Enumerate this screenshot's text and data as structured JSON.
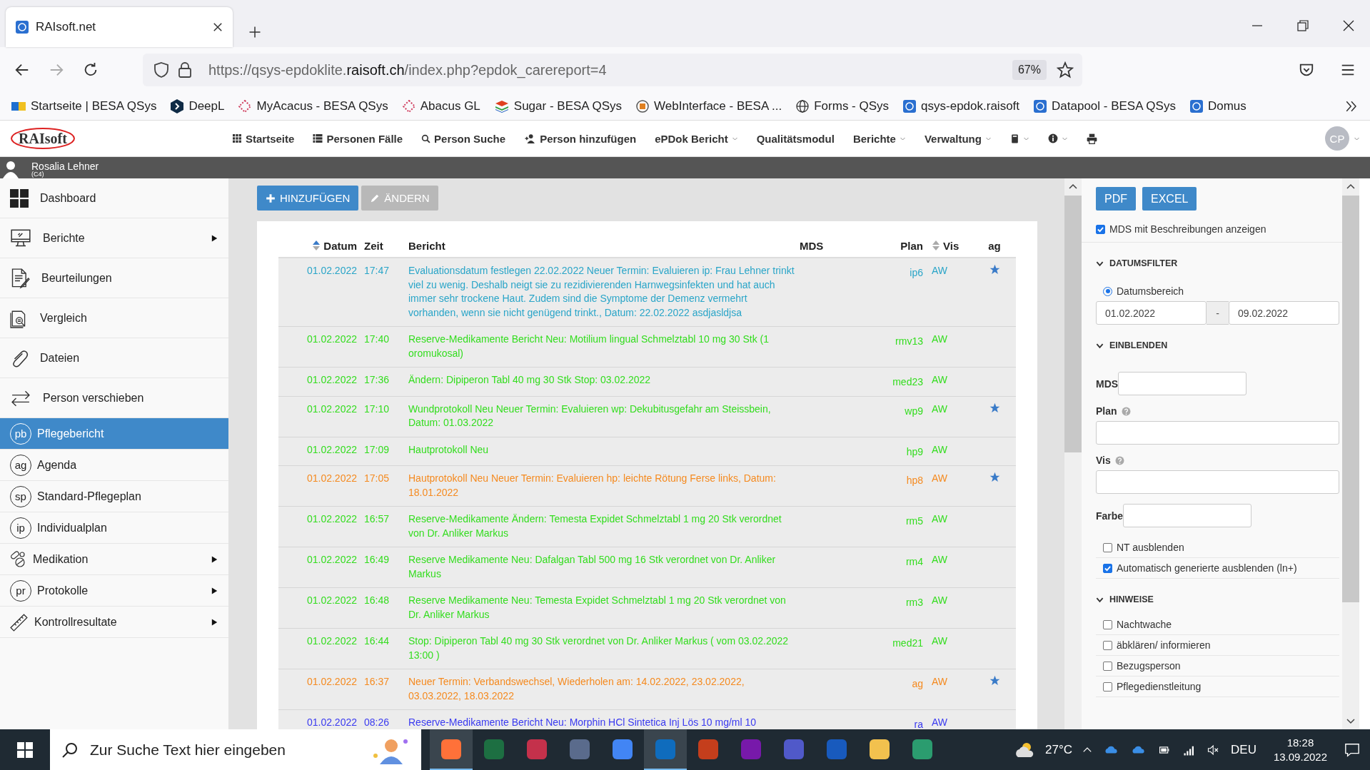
{
  "browser": {
    "tab_title": "RAIsoft.net",
    "url_prefix": "https://qsys-epdoklite.",
    "url_domain": "raisoft.ch",
    "url_path": "/index.php?epdok_carereport=4",
    "zoom": "67%",
    "bookmarks": [
      {
        "label": "Startseite | BESA QSys",
        "kind": "flag"
      },
      {
        "label": "DeepL",
        "kind": "shield"
      },
      {
        "label": "MyAcacus - BESA QSys",
        "kind": "diamond"
      },
      {
        "label": "Abacus GL",
        "kind": "diamond"
      },
      {
        "label": "Sugar - BESA QSys",
        "kind": "stack"
      },
      {
        "label": "WebInterface - BESA ...",
        "kind": "seal"
      },
      {
        "label": "Forms - QSys",
        "kind": "globe"
      },
      {
        "label": "qsys-epdok.raisoft",
        "kind": "app"
      },
      {
        "label": "Datapool - BESA QSys",
        "kind": "app"
      },
      {
        "label": "Domus",
        "kind": "app"
      }
    ]
  },
  "app_header": {
    "logo": "RAIsoft",
    "avatar": "CP",
    "nav": [
      {
        "label": "Startseite",
        "kind": "grid",
        "dropdown": false
      },
      {
        "label": "Personen Fälle",
        "kind": "list",
        "dropdown": false
      },
      {
        "label": "Person Suche",
        "kind": "search",
        "dropdown": false
      },
      {
        "label": "Person hinzufügen",
        "kind": "user-plus",
        "dropdown": false
      },
      {
        "label": "ePDok Bericht",
        "kind": "text",
        "dropdown": true
      },
      {
        "label": "Qualitätsmodul",
        "kind": "text",
        "dropdown": false
      },
      {
        "label": "Berichte",
        "kind": "text",
        "dropdown": true
      },
      {
        "label": "Verwaltung",
        "kind": "text",
        "dropdown": true
      },
      {
        "kind": "book",
        "dropdown": true
      },
      {
        "kind": "info",
        "dropdown": true
      },
      {
        "kind": "print",
        "dropdown": false
      }
    ]
  },
  "person": {
    "name": "Rosalia Lehner",
    "room": "(C4)"
  },
  "sidebar": {
    "items": [
      {
        "label": "Dashboard",
        "kind": "dashboard",
        "submenu": false,
        "selected": false
      },
      {
        "label": "Berichte",
        "kind": "monitor",
        "submenu": true,
        "selected": false
      },
      {
        "label": "Beurteilungen",
        "kind": "document",
        "submenu": false,
        "selected": false
      },
      {
        "label": "Vergleich",
        "kind": "compare",
        "submenu": false,
        "selected": false
      },
      {
        "label": "Dateien",
        "kind": "paperclip",
        "submenu": false,
        "selected": false
      },
      {
        "label": "Person verschieben",
        "kind": "arrows",
        "submenu": false,
        "selected": false
      },
      {
        "label": "Pflegebericht",
        "kind": "badge",
        "badge": "pb",
        "submenu": false,
        "selected": true
      },
      {
        "label": "Agenda",
        "kind": "badge",
        "badge": "ag",
        "submenu": false,
        "selected": false
      },
      {
        "label": "Standard-Pflegeplan",
        "kind": "badge",
        "badge": "sp",
        "submenu": false,
        "selected": false
      },
      {
        "label": "Individualplan",
        "kind": "badge",
        "badge": "ip",
        "submenu": false,
        "selected": false
      },
      {
        "label": "Medikation",
        "kind": "pills",
        "submenu": true,
        "selected": false
      },
      {
        "label": "Protokolle",
        "kind": "badge",
        "badge": "pr",
        "submenu": true,
        "selected": false
      },
      {
        "label": "Kontrollresultate",
        "kind": "ruler",
        "submenu": true,
        "selected": false
      }
    ]
  },
  "toolbar": {
    "buttons": [
      {
        "label": "HINZUFÜGEN",
        "kind": "add",
        "disabled": false
      },
      {
        "label": "ÄNDERN",
        "kind": "edit",
        "disabled": true
      }
    ]
  },
  "table": {
    "columns": [
      {
        "label": "Datum",
        "sortable": true,
        "sorted": true
      },
      {
        "label": "Zeit",
        "sortable": false
      },
      {
        "label": "Bericht",
        "sortable": false
      },
      {
        "label": "MDS",
        "sortable": false
      },
      {
        "label": "Plan",
        "sortable": false
      },
      {
        "label": "Vis",
        "sortable": true,
        "sorted": false
      },
      {
        "label": "ag",
        "sortable": false
      }
    ],
    "rows": [
      {
        "datum": "01.02.2022",
        "zeit": "17:47",
        "bericht": "Evaluationsdatum festlegen 22.02.2022 Neuer Termin: Evaluieren ip: Frau Lehner trinkt viel zu wenig. Deshalb neigt sie zu rezidivierenden Harnwegsinfekten und hat auch immer sehr trockene Haut. Zudem sind die Symptome der Demenz vermehrt vorhanden, wenn sie nicht genügend trinkt., Datum: 22.02.2022 asdjasldjsa",
        "plan": "ip6",
        "vis": "AW",
        "starred": true,
        "color": "#2aa5c8"
      },
      {
        "datum": "01.02.2022",
        "zeit": "17:40",
        "bericht": "Reserve-Medikamente Bericht Neu: Motilium lingual Schmelztabl 10 mg 30 Stk (1 oromukosal)",
        "plan": "rmv13",
        "vis": "AW",
        "starred": false,
        "color": "#33dd1e"
      },
      {
        "datum": "01.02.2022",
        "zeit": "17:36",
        "bericht": "Ändern: Dipiperon Tabl 40 mg 30 Stk Stop: 03.02.2022",
        "plan": "med23",
        "vis": "AW",
        "starred": false,
        "color": "#33dd1e"
      },
      {
        "datum": "01.02.2022",
        "zeit": "17:10",
        "bericht": "Wundprotokoll Neu Neuer Termin: Evaluieren wp: Dekubitusgefahr am Steissbein, Datum: 01.03.2022",
        "plan": "wp9",
        "vis": "AW",
        "starred": true,
        "color": "#33dd1e"
      },
      {
        "datum": "01.02.2022",
        "zeit": "17:09",
        "bericht": "Hautprotokoll Neu",
        "plan": "hp9",
        "vis": "AW",
        "starred": false,
        "color": "#33dd1e"
      },
      {
        "datum": "01.02.2022",
        "zeit": "17:05",
        "bericht": "Hautprotokoll Neu Neuer Termin: Evaluieren hp: leichte Rötung Ferse links, Datum: 18.01.2022",
        "plan": "hp8",
        "vis": "AW",
        "starred": true,
        "color": "#f58a1f"
      },
      {
        "datum": "01.02.2022",
        "zeit": "16:57",
        "bericht": "Reserve-Medikamente Ändern: Temesta Expidet Schmelztabl 1 mg 20 Stk verordnet von Dr. Anliker Markus",
        "plan": "rm5",
        "vis": "AW",
        "starred": false,
        "color": "#33dd1e"
      },
      {
        "datum": "01.02.2022",
        "zeit": "16:49",
        "bericht": "Reserve Medikamente Neu: Dafalgan Tabl 500 mg 16 Stk verordnet von Dr. Anliker Markus",
        "plan": "rm4",
        "vis": "AW",
        "starred": false,
        "color": "#33dd1e"
      },
      {
        "datum": "01.02.2022",
        "zeit": "16:48",
        "bericht": "Reserve Medikamente Neu: Temesta Expidet Schmelztabl 1 mg 20 Stk verordnet von Dr. Anliker Markus",
        "plan": "rm3",
        "vis": "AW",
        "starred": false,
        "color": "#33dd1e"
      },
      {
        "datum": "01.02.2022",
        "zeit": "16:44",
        "bericht": "Stop: Dipiperon Tabl 40 mg 30 Stk verordnet von Dr. Anliker Markus ( vom 03.02.2022 13:00 )",
        "plan": "med21",
        "vis": "AW",
        "starred": false,
        "color": "#33dd1e"
      },
      {
        "datum": "01.02.2022",
        "zeit": "16:37",
        "bericht": "Neuer Termin: Verbandswechsel, Wiederholen am: 14.02.2022, 23.02.2022, 03.03.2022, 18.03.2022",
        "plan": "ag",
        "vis": "AW",
        "starred": true,
        "color": "#f58a1f"
      },
      {
        "datum": "01.02.2022",
        "zeit": "08:26",
        "bericht": "Reserve-Medikamente Bericht Neu: Morphin HCl Sintetica Inj Lös 10 mg/ml 10",
        "plan": "ra",
        "vis": "AW",
        "starred": false,
        "color": "#3a3af0"
      }
    ]
  },
  "right_panel": {
    "buttons": [
      "PDF",
      "EXCEL"
    ],
    "mds_desc": {
      "label": "MDS mit Beschreibungen anzeigen",
      "checked": true
    },
    "date_filter": {
      "title": "DATUMSFILTER",
      "expanded": true,
      "radio": {
        "label": "Datumsbereich",
        "selected": true
      },
      "from": "01.02.2022",
      "separator": "-",
      "to": "09.02.2022"
    },
    "einblenden": {
      "title": "EINBLENDEN",
      "expanded": true,
      "fields": [
        {
          "label": "MDS",
          "kind": "inline",
          "help": false
        },
        {
          "label": "Plan",
          "kind": "stacked",
          "help": true
        },
        {
          "label": "Vis",
          "kind": "stacked",
          "help": true
        },
        {
          "label": "Farbe",
          "kind": "inline",
          "help": false
        }
      ],
      "options": [
        {
          "label": "NT ausblenden",
          "checked": false
        },
        {
          "label": "Automatisch generierte ausblenden (ln+)",
          "checked": true
        }
      ]
    },
    "hinweise": {
      "title": "HINWEISE",
      "expanded": true,
      "options": [
        {
          "label": "Nachtwache",
          "checked": false
        },
        {
          "label": "äbklären/ informieren",
          "checked": false
        },
        {
          "label": "Bezugsperson",
          "checked": false
        },
        {
          "label": "Pflegedienstleitung",
          "checked": false
        }
      ]
    }
  },
  "taskbar": {
    "search_placeholder": "Zur Suche Text hier eingeben",
    "apps": [
      {
        "color": "#ff7139",
        "active": true
      },
      {
        "color": "#1d6f42",
        "active": false
      },
      {
        "color": "#c4314b",
        "active": false
      },
      {
        "color": "#5a6b8c",
        "active": false
      },
      {
        "color": "#4285f4",
        "active": false
      },
      {
        "color": "#0f6cbd",
        "active": true
      },
      {
        "color": "#c43e1c",
        "active": false
      },
      {
        "color": "#7719aa",
        "active": false
      },
      {
        "color": "#5059c9",
        "active": false
      },
      {
        "color": "#185abd",
        "active": false
      },
      {
        "color": "#f2c14e",
        "active": false
      },
      {
        "color": "#2b9c6f",
        "active": false
      }
    ],
    "temperature": "27°C",
    "language": "DEU",
    "time": "18:28",
    "date": "13.09.2022"
  }
}
